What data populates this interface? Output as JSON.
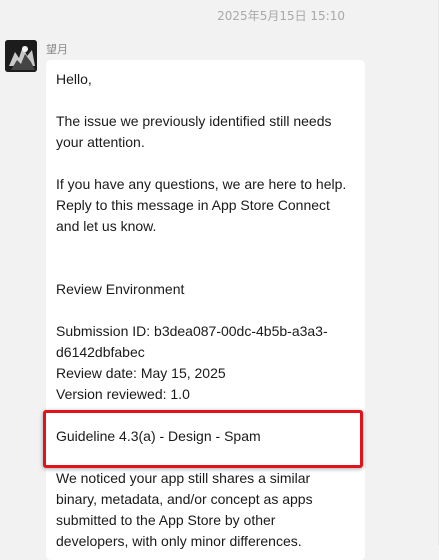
{
  "chat": {
    "timestamp": "2025年5月15日 15:10",
    "sender_name": "望月",
    "message_lines": [
      "Hello,",
      "The issue we previously identified still needs",
      "your attention.",
      "If you have any questions, we are here to help.",
      "Reply to this message in App Store Connect",
      "and let us know.",
      "Review Environment",
      "Submission ID: b3dea087-00dc-4b5b-a3a3-",
      "d6142dbfabec",
      "Review date: May 15, 2025",
      "Version reviewed: 1.0",
      "Guideline 4.3(a) - Design - Spam",
      "We noticed your app still shares a similar",
      "binary, metadata, and/or concept as apps",
      "submitted to the App Store by other",
      "developers, with only minor differences."
    ]
  },
  "colors": {
    "highlight": "#e0121a",
    "background": "#f2f2f2",
    "bubble": "#ffffff"
  }
}
